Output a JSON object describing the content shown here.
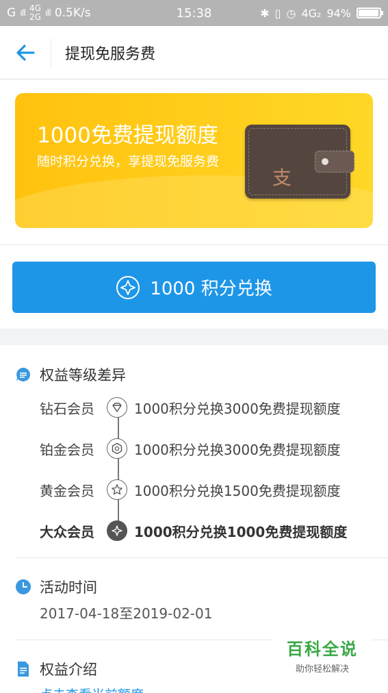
{
  "status_bar": {
    "carrier1": "G",
    "net_top": "4G",
    "net_bottom": "2G",
    "speed": "0.5K/s",
    "time": "15:38",
    "net_right": "4G₂",
    "battery": "94%"
  },
  "header": {
    "back_icon": "arrow-left-icon",
    "title": "提现免服务费"
  },
  "banner": {
    "title": "1000免费提现额度",
    "subtitle": "随时积分兑换，享提现免服务费",
    "wallet_glyph": "支"
  },
  "exchange_button": {
    "label": "1000 积分兑换"
  },
  "benefits": {
    "heading": "权益等级差异",
    "levels": [
      {
        "name": "钻石会员",
        "desc": "1000积分兑换3000免费提现额度",
        "icon": "diamond-icon"
      },
      {
        "name": "铂金会员",
        "desc": "1000积分兑换3000免费提现额度",
        "icon": "hexagon-icon"
      },
      {
        "name": "黄金会员",
        "desc": "1000积分兑换1500免费提现额度",
        "icon": "star-icon"
      },
      {
        "name": "大众会员",
        "desc": "1000积分兑换1000免费提现额度",
        "icon": "compass-icon",
        "current": true
      }
    ]
  },
  "activity": {
    "heading": "活动时间",
    "range": "2017-04-18至2019-02-01"
  },
  "intro": {
    "heading": "权益介绍",
    "link_partial": "点击查看当前额度"
  },
  "watermark": {
    "big": "百科全说",
    "small": "助你轻松解决"
  },
  "colors": {
    "accent": "#1e96e8",
    "banner": "#ffc20e",
    "status_bar": "#b4b4b4"
  }
}
